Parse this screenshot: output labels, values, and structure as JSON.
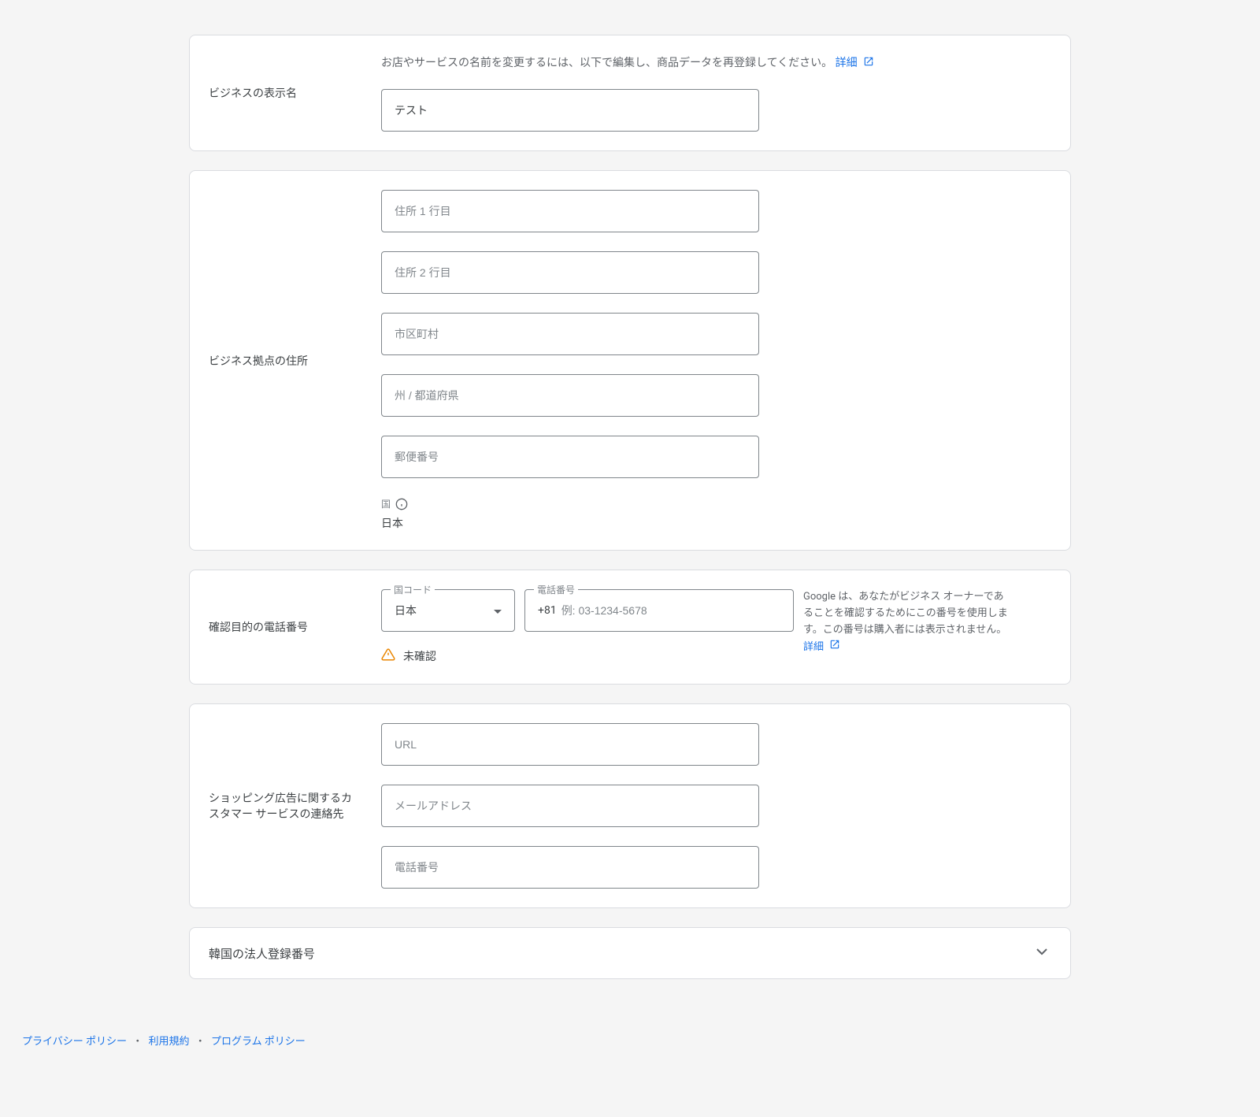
{
  "businessName": {
    "label": "ビジネスの表示名",
    "helpText": "お店やサービスの名前を変更するには、以下で編集し、商品データを再登録してください。 ",
    "linkText": "詳細",
    "value": "テスト"
  },
  "businessAddress": {
    "label": "ビジネス拠点の住所",
    "address1Placeholder": "住所 1 行目",
    "address2Placeholder": "住所 2 行目",
    "cityPlaceholder": "市区町村",
    "statePlaceholder": "州 / 都道府県",
    "postalPlaceholder": "郵便番号",
    "countryLabel": "国",
    "countryValue": "日本"
  },
  "phone": {
    "label": "確認目的の電話番号",
    "countryCodeLabel": "国コード",
    "countryCodeValue": "日本",
    "phoneLabel": "電話番号",
    "phonePrefix": "+81",
    "phonePlaceholder": "例: 03-1234-5678",
    "statusText": "未確認",
    "description": "Google は、あなたがビジネス オーナーであることを確認するためにこの番号を使用します。この番号は購入者には表示されません。",
    "linkText": "詳細"
  },
  "customerService": {
    "label": "ショッピング広告に関するカスタマー サービスの連絡先",
    "urlPlaceholder": "URL",
    "emailPlaceholder": "メールアドレス",
    "phonePlaceholder": "電話番号"
  },
  "koreanRegistration": {
    "title": "韓国の法人登録番号"
  },
  "footer": {
    "privacy": "プライバシー ポリシー",
    "terms": "利用規約",
    "program": "プログラム ポリシー",
    "sep": "・"
  }
}
